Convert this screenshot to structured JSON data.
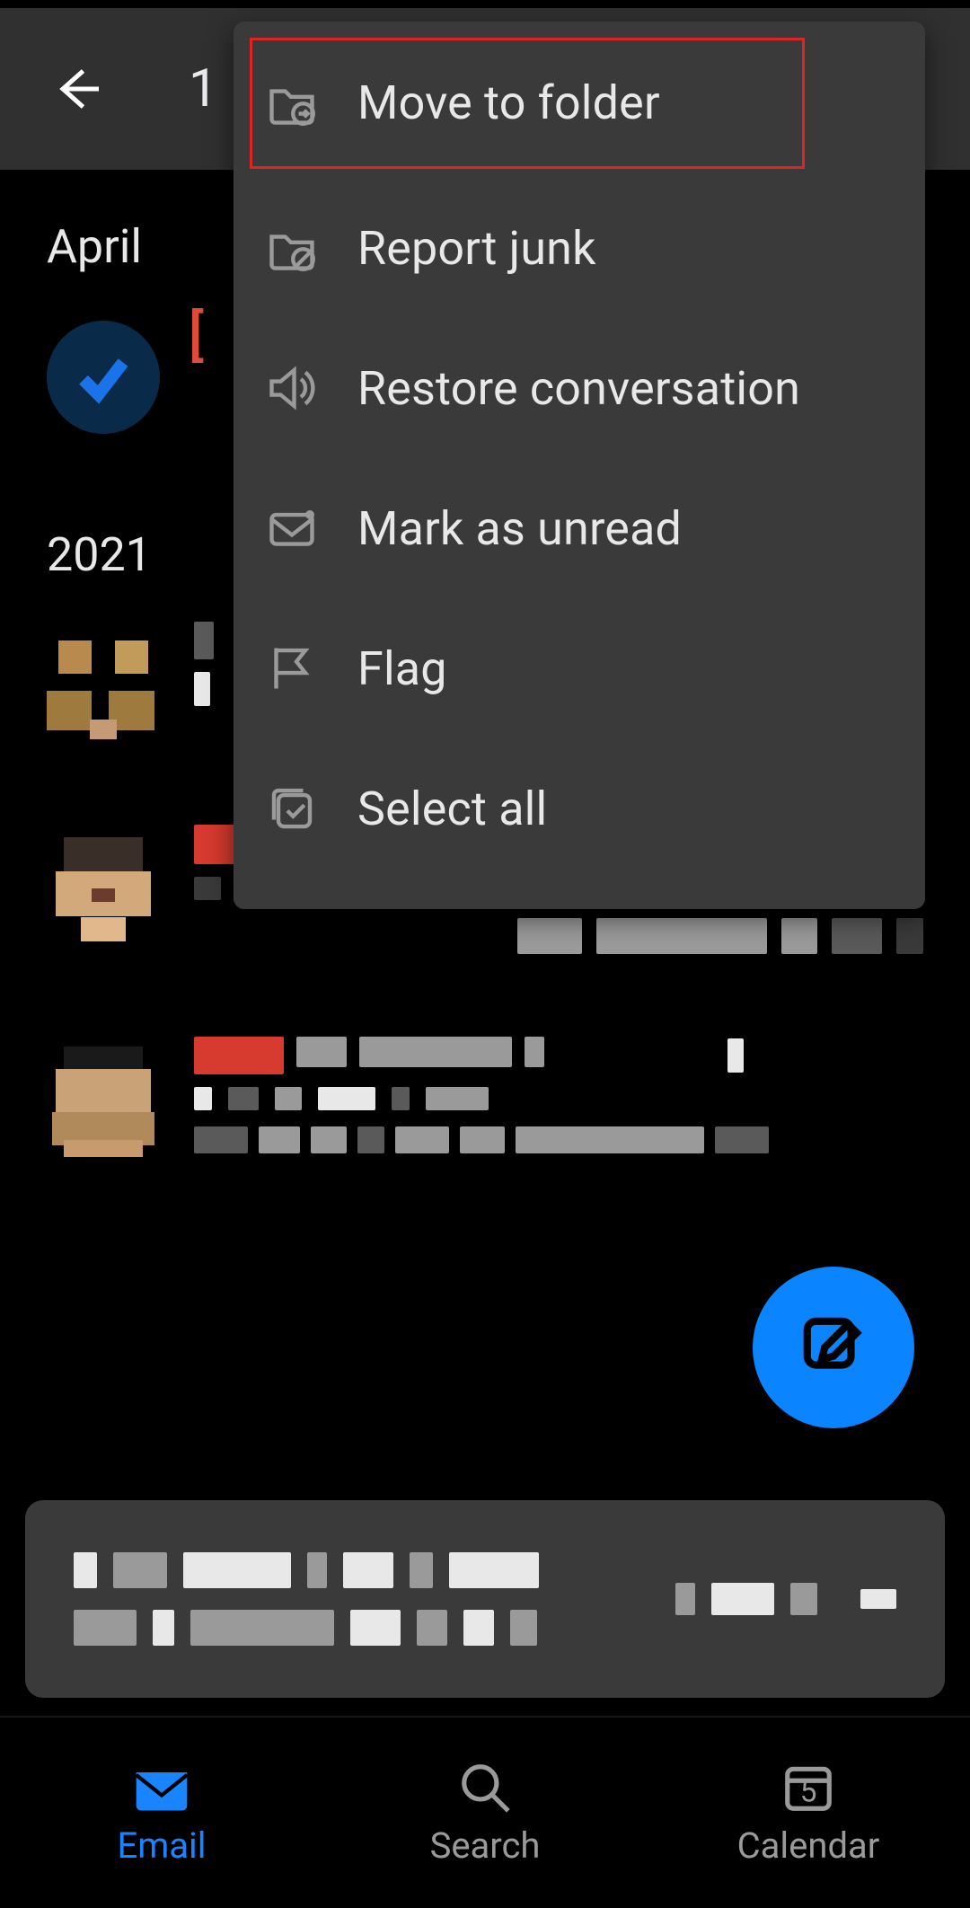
{
  "selectionBar": {
    "count": "1"
  },
  "sections": {
    "april": "April",
    "year2021": "2021"
  },
  "menu": {
    "moveToFolder": "Move to folder",
    "reportJunk": "Report junk",
    "restoreConversation": "Restore conversation",
    "markAsUnread": "Mark as unread",
    "flag": "Flag",
    "selectAll": "Select all"
  },
  "tabs": {
    "email": "Email",
    "search": "Search",
    "calendar": "Calendar",
    "calendarDay": "5"
  },
  "colors": {
    "accent": "#1a84ff",
    "menuBg": "#3a3a3a",
    "danger": "#e02424"
  }
}
